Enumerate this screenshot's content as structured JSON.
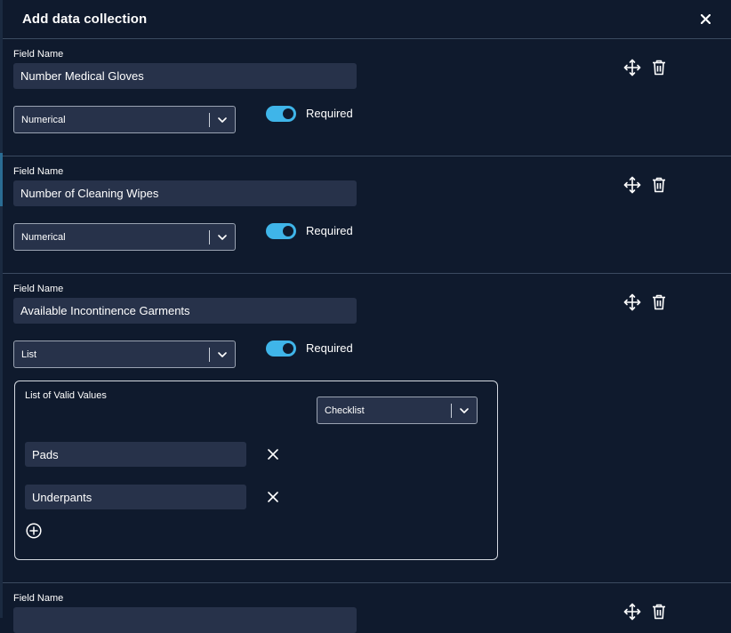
{
  "header": {
    "title": "Add data collection"
  },
  "sections": [
    {
      "field_label": "Field Name",
      "field_value": "Number Medical Gloves",
      "type": "Numerical",
      "required_label": "Required",
      "required": true
    },
    {
      "field_label": "Field Name",
      "field_value": "Number of Cleaning Wipes",
      "type": "Numerical",
      "required_label": "Required",
      "required": true
    },
    {
      "field_label": "Field Name",
      "field_value": "Available Incontinence Garments",
      "type": "List",
      "required_label": "Required",
      "required": true,
      "list": {
        "label": "List of Valid Values",
        "display_type": "Checklist",
        "values": [
          "Pads",
          "Underpants"
        ]
      }
    },
    {
      "field_label": "Field Name"
    }
  ]
}
